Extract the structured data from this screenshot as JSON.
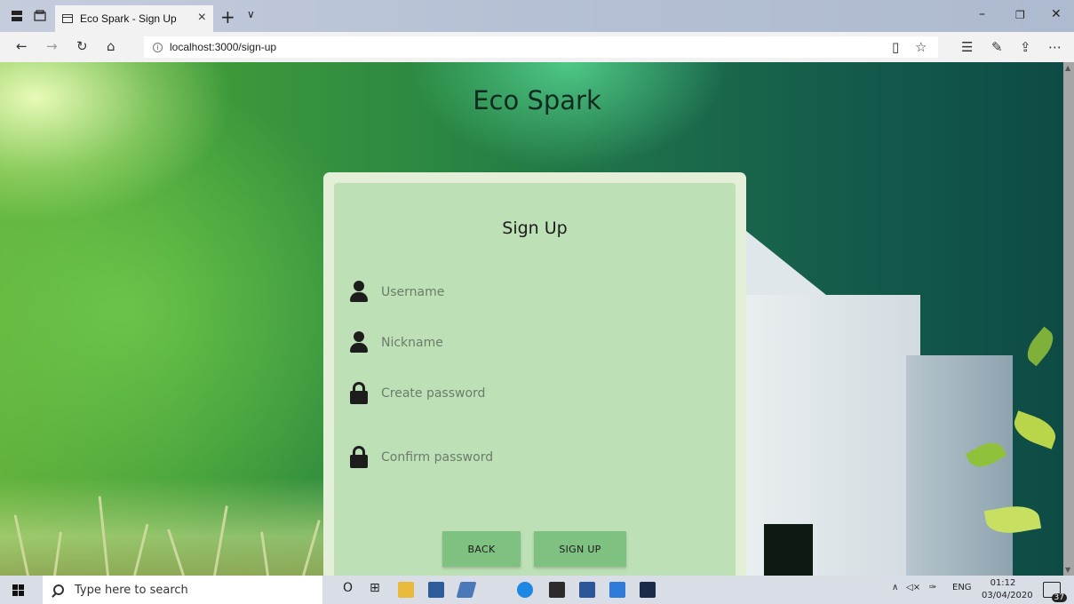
{
  "browser": {
    "tab_title": "Eco Spark - Sign Up",
    "tab_close": "×",
    "new_tab": "+",
    "tab_list": "∨",
    "url": "localhost:3000/sign-up",
    "window": {
      "minimize": "–",
      "restore": "❐",
      "close": "✕"
    },
    "nav": {
      "back": "←",
      "forward": "→",
      "refresh": "↻",
      "home": "⌂",
      "info": "i"
    },
    "toolbar_right": {
      "reading_view": "▯",
      "favorite": "☆",
      "favorites_hub": "☰",
      "notes": "✎",
      "share": "⇪",
      "more": "⋯"
    }
  },
  "page": {
    "site_title": "Eco Spark",
    "form": {
      "title": "Sign Up",
      "fields": [
        {
          "name": "username",
          "icon": "user-icon",
          "placeholder": "Username",
          "type": "text"
        },
        {
          "name": "nickname",
          "icon": "user-icon",
          "placeholder": "Nickname",
          "type": "text"
        },
        {
          "name": "create-password",
          "icon": "lock-icon",
          "placeholder": "Create password",
          "type": "password"
        },
        {
          "name": "confirm-password",
          "icon": "lock-icon",
          "placeholder": "Confirm password",
          "type": "password"
        }
      ],
      "back_label": "BACK",
      "signup_label": "SIGN UP"
    }
  },
  "taskbar": {
    "search_placeholder": "Type here to search",
    "cortana": "O",
    "task_view": "⊞",
    "tray": {
      "chevron": "∧",
      "volume": "◁×",
      "pen": "✑",
      "language": "ENG"
    },
    "time": "01:12",
    "date": "03/04/2020",
    "notifications": "37"
  },
  "colors": {
    "card_bg": "#bde0b6",
    "card_border": "#e3efd6",
    "button_bg": "#7fc181",
    "title_color": "#0f2a1f"
  }
}
